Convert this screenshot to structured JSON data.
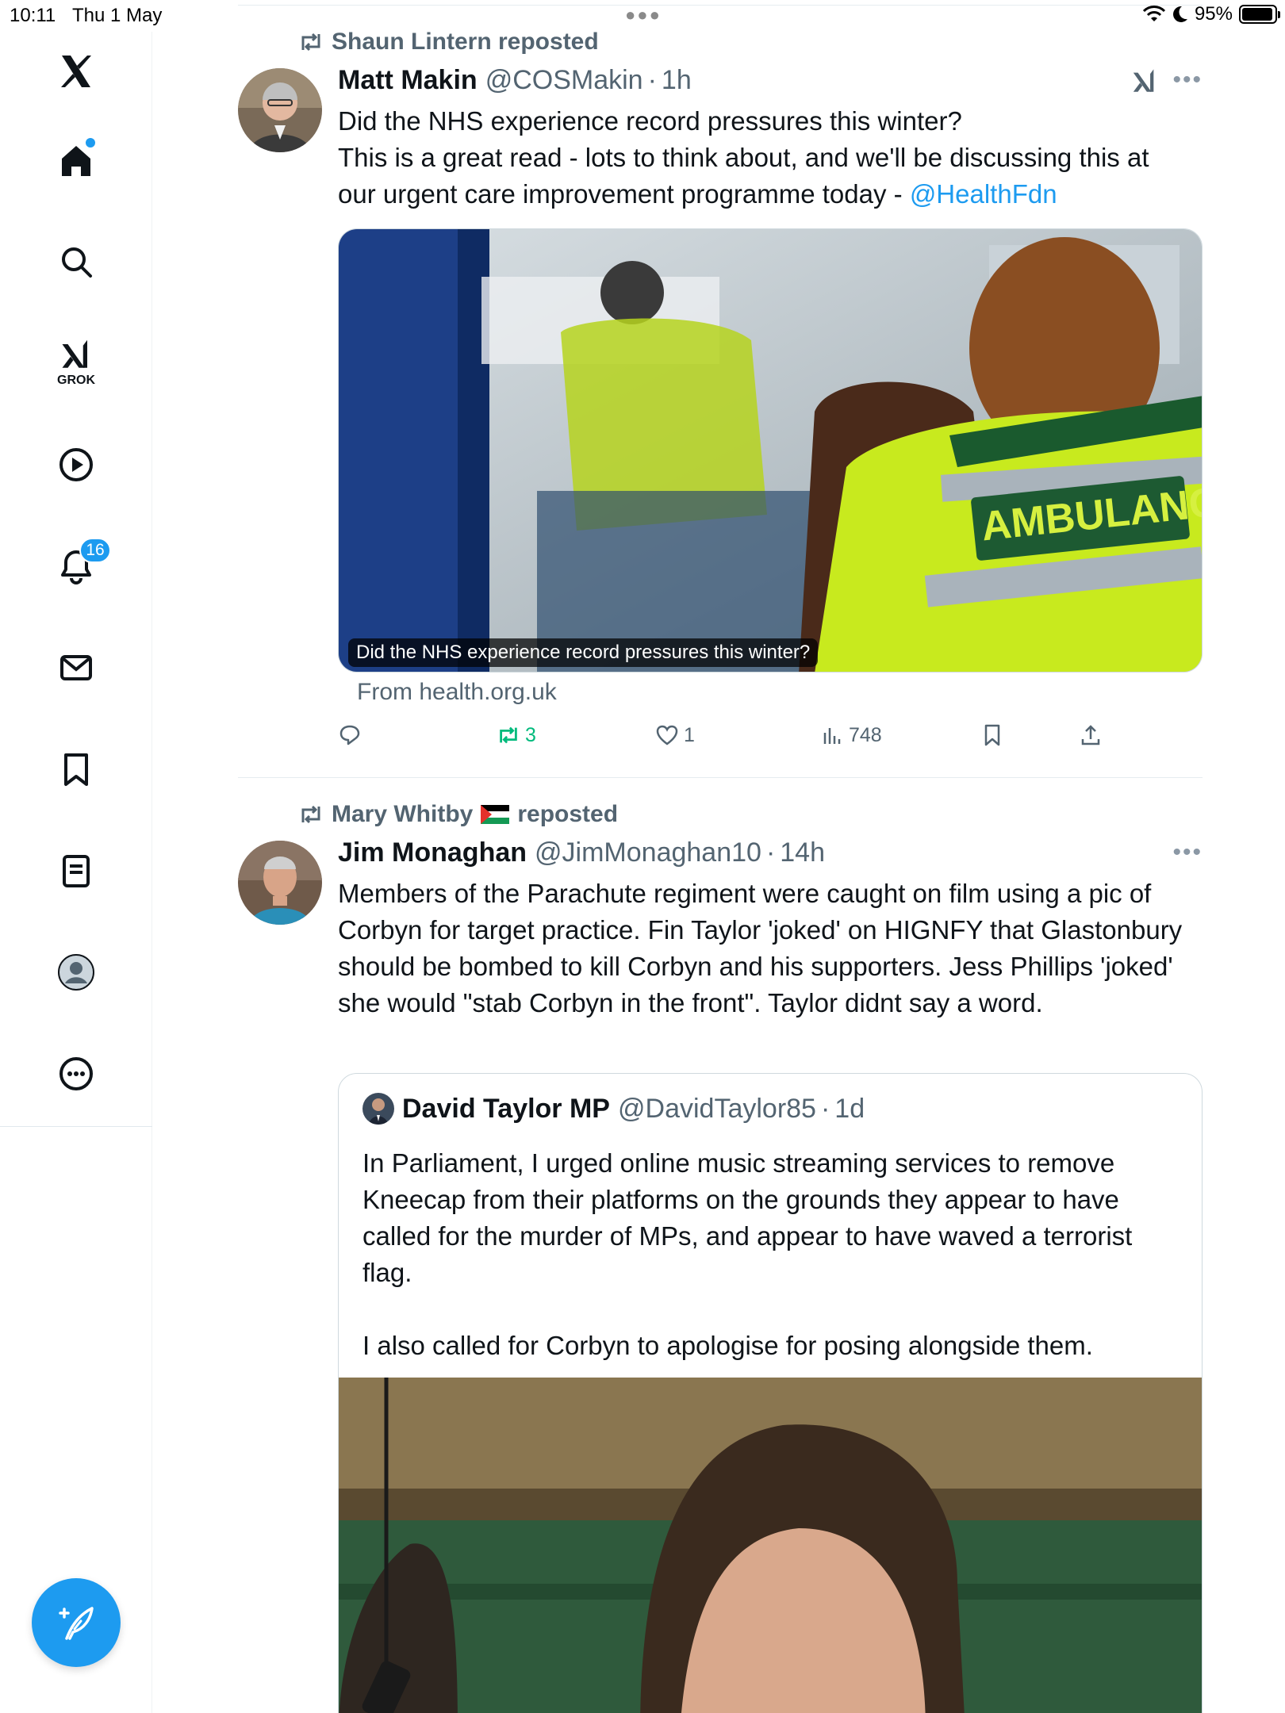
{
  "status_bar": {
    "time": "10:11",
    "date": "Thu 1 May",
    "battery": "95%",
    "battery_level": 0.95
  },
  "sidebar": {
    "items": [
      {
        "name": "x-logo-icon"
      },
      {
        "name": "home-icon"
      },
      {
        "name": "search-icon"
      },
      {
        "name": "grok-icon",
        "label": "GROK"
      },
      {
        "name": "video-icon"
      },
      {
        "name": "notifications-icon",
        "badge": "16"
      },
      {
        "name": "messages-icon"
      },
      {
        "name": "bookmarks-icon"
      },
      {
        "name": "lists-icon"
      },
      {
        "name": "profile-icon"
      },
      {
        "name": "more-icon"
      }
    ],
    "compose_icon": "compose-feather-icon"
  },
  "colors": {
    "accent": "#1d9bf0",
    "muted": "#536471",
    "repost_green": "#00ba7c"
  },
  "tweets": [
    {
      "repost_by": "Shaun Lintern reposted",
      "name": "Matt Makin",
      "handle": "@COSMakin",
      "time": "1h",
      "text_lines": [
        "Did the NHS experience record pressures this winter?",
        "This is a great read - lots to think about, and we'll be discussing this at",
        "our urgent care improvement programme today - "
      ],
      "mention": "@HealthFdn",
      "media_caption": "Did the NHS experience record pressures this winter?",
      "media_text": "AMBULANCE",
      "link_source": "From health.org.uk",
      "actions": {
        "replies": "",
        "reposts": "3",
        "likes": "1",
        "views": "748"
      }
    },
    {
      "repost_by_name": "Mary Whitby",
      "repost_by_suffix": "reposted",
      "name": "Jim Monaghan",
      "handle": "@JimMonaghan10",
      "time": "14h",
      "text": "Members of the Parachute regiment were caught on film using a pic of Corbyn for target practice. Fin Taylor 'joked' on HIGNFY that Glastonbury should be bombed to kill Corbyn and his supporters. Jess Phillips 'joked' she would \"stab Corbyn in the front\". Taylor didnt say a word.",
      "quote": {
        "name": "David Taylor MP",
        "handle": "@DavidTaylor85",
        "time": "1d",
        "text_p1": "In Parliament, I urged online music streaming services to remove Kneecap from their platforms on the grounds they appear to have called for the murder of MPs, and appear to have waved a terrorist flag.",
        "text_p2": "I also called for Corbyn to apologise for posing alongside them."
      }
    }
  ]
}
